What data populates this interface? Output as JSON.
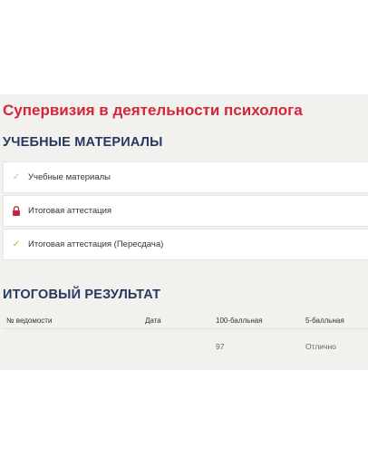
{
  "course": {
    "title": "Супервизия в деятельности психолога"
  },
  "materials": {
    "heading": "УЧЕБНЫЕ МАТЕРИАЛЫ",
    "items": [
      {
        "label": "Учебные материалы",
        "icon": "check-icon"
      },
      {
        "label": "Итоговая аттестация",
        "icon": "lock-icon"
      },
      {
        "label": "Итоговая аттестация (Пересдача)",
        "icon": "check-icon"
      }
    ]
  },
  "results": {
    "heading": "ИТОГОВЫЙ РЕЗУЛЬТАТ",
    "columns": [
      "№ ведомости",
      "Дата",
      "100-балльная",
      "5-балльная"
    ],
    "rows": [
      {
        "statement_no": "",
        "date": "",
        "score_100": "97",
        "score_5": "Отлично"
      }
    ]
  },
  "colors": {
    "title_red": "#d6243a",
    "heading_navy": "#243a5e",
    "check_green": "#8fbf45",
    "lock_red": "#c0283c",
    "panel_bg": "#f2f1ee"
  }
}
